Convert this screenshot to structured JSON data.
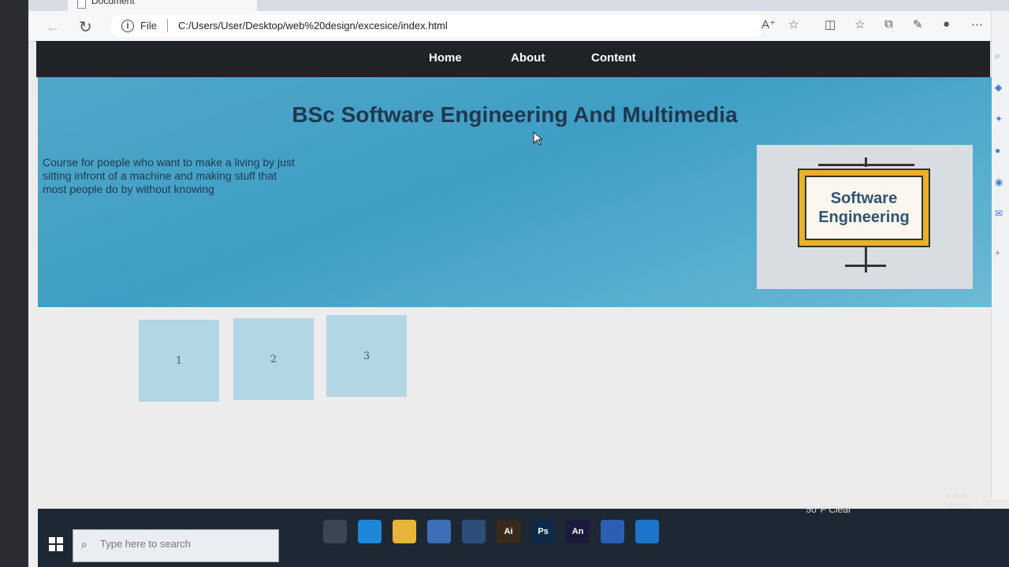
{
  "browser": {
    "tab_title": "Document",
    "file_label": "File",
    "url": "C:/Users/User/Desktop/web%20design/excesice/index.html"
  },
  "page": {
    "nav": [
      "Home",
      "About",
      "Content"
    ],
    "title": "BSc Software Engineering And Multimedia",
    "description": "Course for poeple who want to make a living by just sitting infront of a machine and making stuff that most people do by without knowing",
    "image_text": [
      "Software",
      "Engineering"
    ],
    "boxes": [
      "1",
      "2",
      "3"
    ]
  },
  "taskbar": {
    "search_placeholder": "Type here to search",
    "apps": [
      {
        "name": "task-view",
        "label": "",
        "color": "#3a4652"
      },
      {
        "name": "edge",
        "label": "",
        "color": "#1e88d6"
      },
      {
        "name": "file-explorer",
        "label": "",
        "color": "#e8b43a"
      },
      {
        "name": "store",
        "label": "",
        "color": "#3d6fb8"
      },
      {
        "name": "mail",
        "label": "",
        "color": "#2d4e7a"
      },
      {
        "name": "illustrator",
        "label": "Ai",
        "color": "#3a2a1c"
      },
      {
        "name": "photoshop",
        "label": "Ps",
        "color": "#0f2a48"
      },
      {
        "name": "animate",
        "label": "An",
        "color": "#1a1a3a"
      },
      {
        "name": "word",
        "label": "",
        "color": "#2b5fb4"
      },
      {
        "name": "vscode",
        "label": "",
        "color": "#1c75c8"
      }
    ],
    "weather": "50°F  Clear",
    "time": "6:46 PM",
    "date": "9/7/2023"
  },
  "colors": {
    "nav_bg": "#1f2226",
    "hero_bg": "#4fa7c9",
    "title_color": "#21374f",
    "box_bg": "#b2d6e3"
  }
}
